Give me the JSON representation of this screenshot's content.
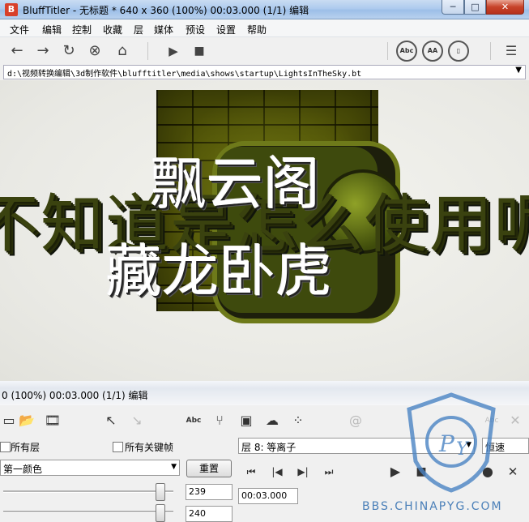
{
  "window": {
    "title": "BluffTitler - 无标题 * 640 x 360 (100%) 00:03.000 (1/1) 编辑",
    "icon_letter": "B",
    "min": "─",
    "max": "□",
    "close": "✕"
  },
  "menu": [
    "文件",
    "编辑",
    "控制",
    "收藏",
    "层",
    "媒体",
    "预设",
    "设置",
    "帮助"
  ],
  "toolbar": {
    "icons": [
      "back-arrow-icon",
      "forward-arrow-icon",
      "refresh-icon",
      "stop-circle-icon",
      "home-icon",
      "play-icon",
      "stop-icon"
    ],
    "round_buttons": [
      "Abc",
      "AA",
      "▯"
    ],
    "menu_icon": "hamburger-icon"
  },
  "path": "d:\\视频转换编辑\\3d制作软件\\blufftitler\\media\\shows\\startup\\LightsInTheSky.bt",
  "canvas": {
    "background_text": "不知道是怎么使用呢",
    "line1": "飘云阁",
    "line2": "藏龙卧虎"
  },
  "status": "0 (100%) 00:03.000 (1/1) 编辑",
  "panel": {
    "all_layers": "所有层",
    "all_keyframes": "所有关键帧",
    "color_select": "第一颜色",
    "reset": "重置",
    "value1": "239",
    "value2": "240",
    "layer_select": "层 8: 等离子",
    "speed": "恒速",
    "time": "00:03.000",
    "tool_labels": {
      "abc": "Abc"
    }
  },
  "watermark": "BBS.CHINAPYG.COM",
  "colors": {
    "accent": "#3d6fcf",
    "brick": "#4f5208",
    "title_gradient": "#aecbee"
  }
}
